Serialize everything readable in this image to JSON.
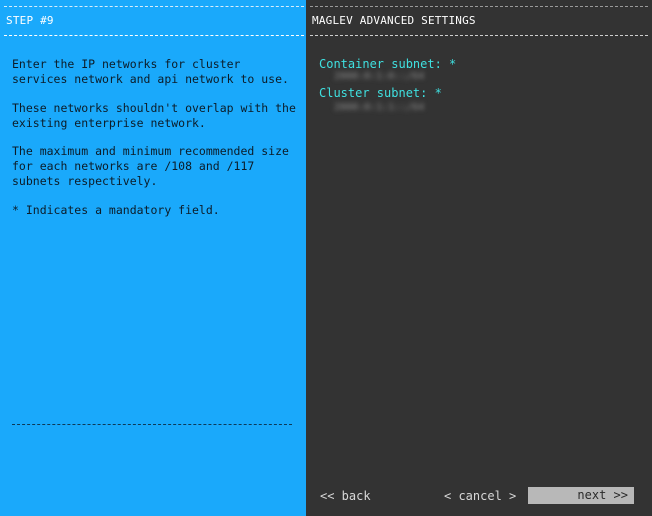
{
  "left_pane": {
    "title": "STEP #9",
    "help_lines": [
      "Enter the IP networks for cluster\nservices network and api network to use.",
      "These networks shouldn't overlap with the\nexisting enterprise network.",
      "The maximum and minimum recommended size\nfor each networks are /108 and /117\nsubnets respectively.",
      "* Indicates a mandatory field."
    ],
    "background_color": "#1aa9fb"
  },
  "right_pane": {
    "title": "MAGLEV ADVANCED SETTINGS",
    "background_color": "#333333",
    "fields": [
      {
        "label": "Container subnet: *",
        "value": "2000:0:1:0::/64"
      },
      {
        "label": "Cluster subnet: *",
        "value": "2000:0:1:1::/64"
      }
    ],
    "label_color": "#3fe0e0"
  },
  "navigation": {
    "back_label": "<< back",
    "cancel_label": "< cancel >",
    "next_label": "next >>"
  }
}
